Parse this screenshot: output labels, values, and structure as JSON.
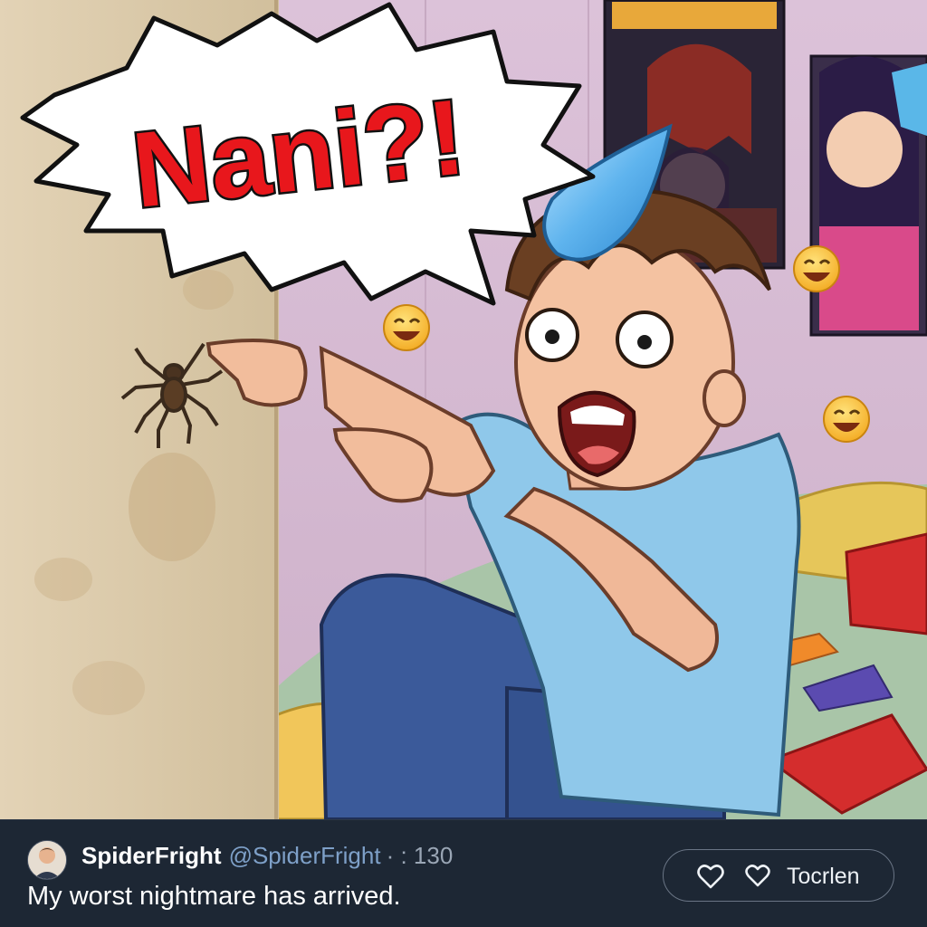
{
  "meme": {
    "speech_bubble_text": "Nani?!"
  },
  "post": {
    "display_name": "SpiderFright",
    "handle": "@SpiderFright",
    "meta": "· : 130",
    "text": "My worst nightmare has arrived.",
    "actions": {
      "like_icon": "heart-icon",
      "reply_icon": "speech-bubble-icon",
      "label": "Tocrlen"
    }
  },
  "colors": {
    "post_bar_bg": "#1d2734",
    "handle": "#7ea0c8",
    "bubble_text": "#e8171c",
    "wall": "#d8c7a6",
    "room_wall": "#d9bfd6"
  }
}
